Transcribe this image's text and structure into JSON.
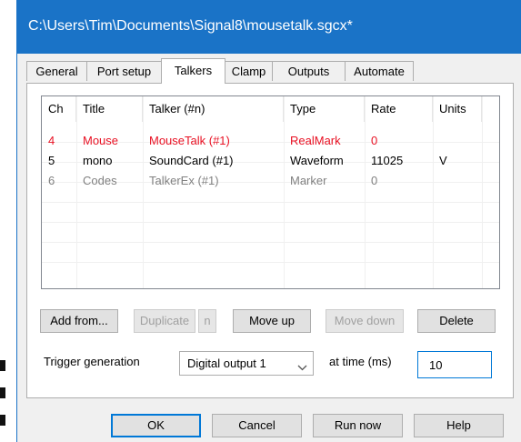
{
  "window": {
    "title": "C:\\Users\\Tim\\Documents\\Signal8\\mousetalk.sgcx*"
  },
  "tabs": [
    {
      "label": "General",
      "active": false
    },
    {
      "label": "Port setup",
      "active": false
    },
    {
      "label": "Talkers",
      "active": true
    },
    {
      "label": "Clamp",
      "active": false
    },
    {
      "label": "Outputs",
      "active": false
    },
    {
      "label": "Automate",
      "active": false
    }
  ],
  "table": {
    "columns": [
      "Ch",
      "Title",
      "Talker (#n)",
      "Type",
      "Rate",
      "Units"
    ],
    "rows": [
      {
        "ch": "4",
        "title": "Mouse",
        "talker": "MouseTalk (#1)",
        "type": "RealMark",
        "rate": "0",
        "units": "",
        "color": "#e81123"
      },
      {
        "ch": "5",
        "title": "mono",
        "talker": "SoundCard (#1)",
        "type": "Waveform",
        "rate": "11025",
        "units": "V",
        "color": "#000000"
      },
      {
        "ch": "6",
        "title": "Codes",
        "talker": "TalkerEx (#1)",
        "type": "Marker",
        "rate": "0",
        "units": "",
        "color": "#808080"
      }
    ]
  },
  "buttons": {
    "add_from": "Add from...",
    "duplicate": "Duplicate",
    "n": "n",
    "move_up": "Move up",
    "move_down": "Move down",
    "delete": "Delete"
  },
  "trigger": {
    "label": "Trigger generation",
    "select_value": "Digital output 1",
    "at_time_label": "at time (ms)",
    "time_value": "10"
  },
  "footer": {
    "ok": "OK",
    "cancel": "Cancel",
    "run_now": "Run now",
    "help": "Help"
  },
  "colors": {
    "titlebar": "#1a73c7",
    "row_selected_text": "#e81123",
    "row_disabled_text": "#808080",
    "focus_border": "#0078d7"
  }
}
